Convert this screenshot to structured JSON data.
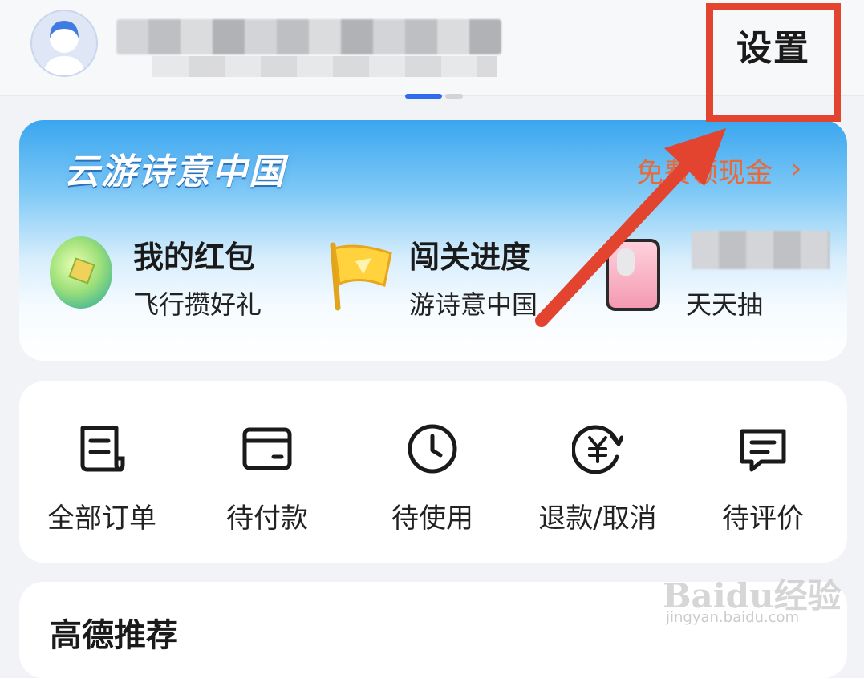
{
  "header": {
    "settings_label": "设置"
  },
  "banner": {
    "title": "云游诗意中国",
    "cta": "免费领现金",
    "cta_arrow": "›",
    "items": [
      {
        "title": "我的红包",
        "subtitle": "飞行攒好礼",
        "icon": "coin-icon"
      },
      {
        "title": "闯关进度",
        "subtitle": "游诗意中国",
        "icon": "flag-icon"
      },
      {
        "title": "",
        "subtitle": "天天抽",
        "icon": "phone-icon"
      }
    ]
  },
  "orders": {
    "items": [
      {
        "label": "全部订单",
        "icon": "orders-list-icon"
      },
      {
        "label": "待付款",
        "icon": "card-icon"
      },
      {
        "label": "待使用",
        "icon": "clock-icon"
      },
      {
        "label": "退款/取消",
        "icon": "refund-icon"
      },
      {
        "label": "待评价",
        "icon": "comment-icon"
      }
    ]
  },
  "recommend": {
    "title": "高德推荐"
  },
  "watermark": {
    "text": "Baidu经验",
    "url": "jingyan.baidu.com"
  },
  "colors": {
    "accent_blue": "#2f6bec",
    "highlight_red": "#e2442f",
    "cta_orange": "#e86a3a"
  }
}
